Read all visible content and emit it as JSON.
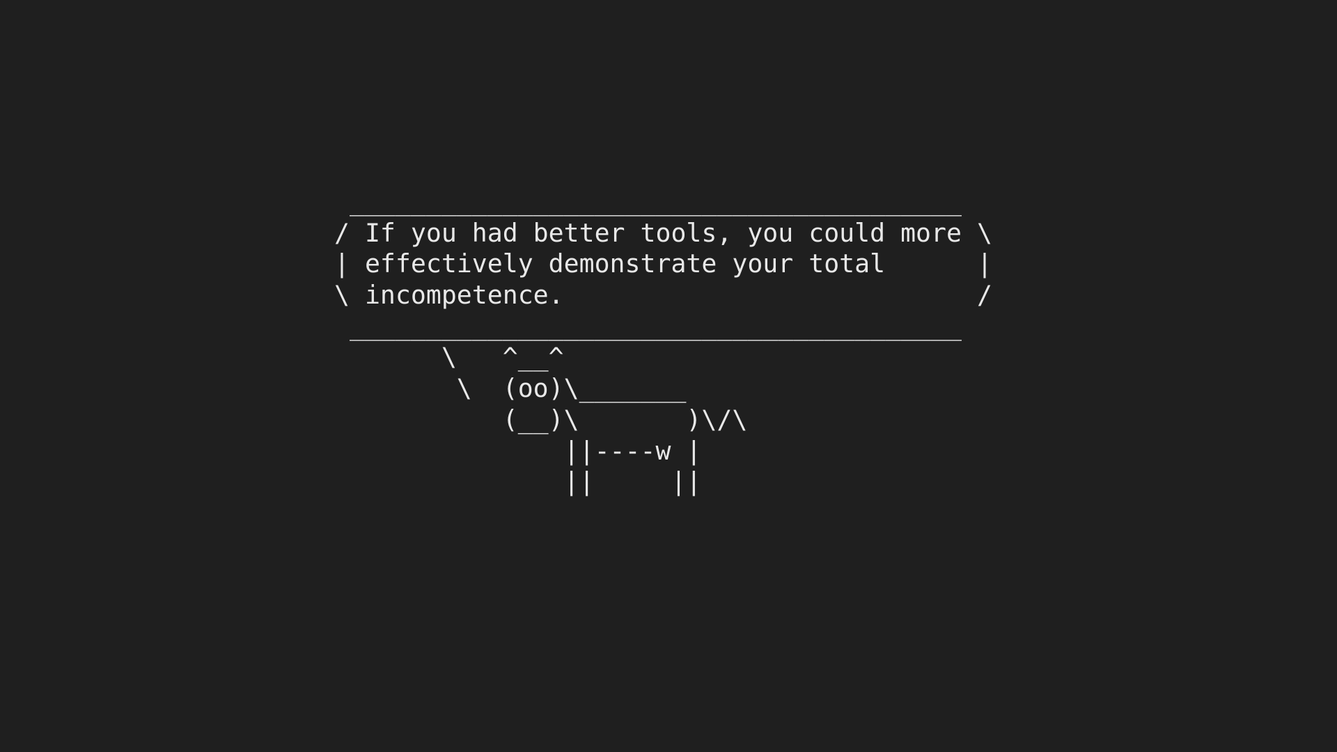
{
  "cowsay": {
    "lines": [
      " ________________________________________",
      "/ If you had better tools, you could more \\",
      "| effectively demonstrate your total      |",
      "\\ incompetence.                           /",
      " ________________________________________",
      "       \\   ^__^",
      "        \\  (oo)\\_______",
      "           (__)\\       )\\/\\",
      "               ||----w |",
      "               ||     ||"
    ]
  },
  "colors": {
    "background": "#1f1f1f",
    "text": "#e8e8e8"
  }
}
